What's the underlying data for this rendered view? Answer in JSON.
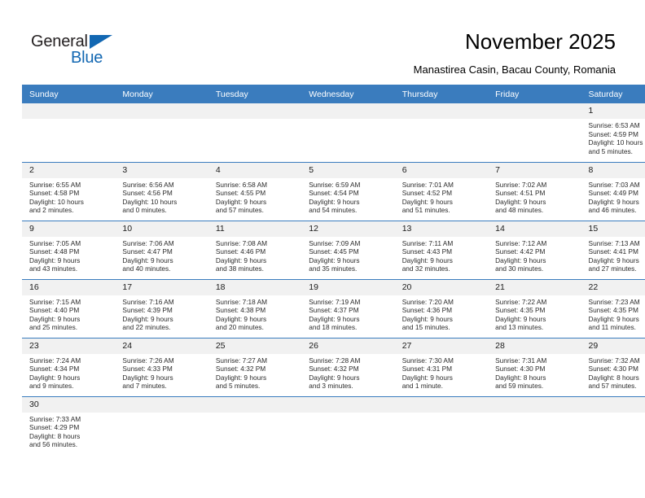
{
  "brand": {
    "name_top": "General",
    "name_bottom": "Blue",
    "triangle_color": "#1267b2",
    "text_color": "#231f20"
  },
  "header": {
    "title": "November 2025",
    "subtitle": "Manastirea Casin, Bacau County, Romania"
  },
  "theme": {
    "header_bg": "#3a7cbe",
    "header_text": "#ffffff",
    "daynum_bg": "#f1f1f1",
    "grid_line": "#3a7cbe",
    "body_text": "#2b2b2b"
  },
  "weekdays": [
    "Sunday",
    "Monday",
    "Tuesday",
    "Wednesday",
    "Thursday",
    "Friday",
    "Saturday"
  ],
  "labels": {
    "sunrise": "Sunrise:",
    "sunset": "Sunset:",
    "daylight": "Daylight:"
  },
  "weeks": [
    [
      {
        "empty": true
      },
      {
        "empty": true
      },
      {
        "empty": true
      },
      {
        "empty": true
      },
      {
        "empty": true
      },
      {
        "empty": true
      },
      {
        "day": "1",
        "sunrise": "Sunrise: 6:53 AM",
        "sunset": "Sunset: 4:59 PM",
        "daylight1": "Daylight: 10 hours",
        "daylight2": "and 5 minutes."
      }
    ],
    [
      {
        "day": "2",
        "sunrise": "Sunrise: 6:55 AM",
        "sunset": "Sunset: 4:58 PM",
        "daylight1": "Daylight: 10 hours",
        "daylight2": "and 2 minutes."
      },
      {
        "day": "3",
        "sunrise": "Sunrise: 6:56 AM",
        "sunset": "Sunset: 4:56 PM",
        "daylight1": "Daylight: 10 hours",
        "daylight2": "and 0 minutes."
      },
      {
        "day": "4",
        "sunrise": "Sunrise: 6:58 AM",
        "sunset": "Sunset: 4:55 PM",
        "daylight1": "Daylight: 9 hours",
        "daylight2": "and 57 minutes."
      },
      {
        "day": "5",
        "sunrise": "Sunrise: 6:59 AM",
        "sunset": "Sunset: 4:54 PM",
        "daylight1": "Daylight: 9 hours",
        "daylight2": "and 54 minutes."
      },
      {
        "day": "6",
        "sunrise": "Sunrise: 7:01 AM",
        "sunset": "Sunset: 4:52 PM",
        "daylight1": "Daylight: 9 hours",
        "daylight2": "and 51 minutes."
      },
      {
        "day": "7",
        "sunrise": "Sunrise: 7:02 AM",
        "sunset": "Sunset: 4:51 PM",
        "daylight1": "Daylight: 9 hours",
        "daylight2": "and 48 minutes."
      },
      {
        "day": "8",
        "sunrise": "Sunrise: 7:03 AM",
        "sunset": "Sunset: 4:49 PM",
        "daylight1": "Daylight: 9 hours",
        "daylight2": "and 46 minutes."
      }
    ],
    [
      {
        "day": "9",
        "sunrise": "Sunrise: 7:05 AM",
        "sunset": "Sunset: 4:48 PM",
        "daylight1": "Daylight: 9 hours",
        "daylight2": "and 43 minutes."
      },
      {
        "day": "10",
        "sunrise": "Sunrise: 7:06 AM",
        "sunset": "Sunset: 4:47 PM",
        "daylight1": "Daylight: 9 hours",
        "daylight2": "and 40 minutes."
      },
      {
        "day": "11",
        "sunrise": "Sunrise: 7:08 AM",
        "sunset": "Sunset: 4:46 PM",
        "daylight1": "Daylight: 9 hours",
        "daylight2": "and 38 minutes."
      },
      {
        "day": "12",
        "sunrise": "Sunrise: 7:09 AM",
        "sunset": "Sunset: 4:45 PM",
        "daylight1": "Daylight: 9 hours",
        "daylight2": "and 35 minutes."
      },
      {
        "day": "13",
        "sunrise": "Sunrise: 7:11 AM",
        "sunset": "Sunset: 4:43 PM",
        "daylight1": "Daylight: 9 hours",
        "daylight2": "and 32 minutes."
      },
      {
        "day": "14",
        "sunrise": "Sunrise: 7:12 AM",
        "sunset": "Sunset: 4:42 PM",
        "daylight1": "Daylight: 9 hours",
        "daylight2": "and 30 minutes."
      },
      {
        "day": "15",
        "sunrise": "Sunrise: 7:13 AM",
        "sunset": "Sunset: 4:41 PM",
        "daylight1": "Daylight: 9 hours",
        "daylight2": "and 27 minutes."
      }
    ],
    [
      {
        "day": "16",
        "sunrise": "Sunrise: 7:15 AM",
        "sunset": "Sunset: 4:40 PM",
        "daylight1": "Daylight: 9 hours",
        "daylight2": "and 25 minutes."
      },
      {
        "day": "17",
        "sunrise": "Sunrise: 7:16 AM",
        "sunset": "Sunset: 4:39 PM",
        "daylight1": "Daylight: 9 hours",
        "daylight2": "and 22 minutes."
      },
      {
        "day": "18",
        "sunrise": "Sunrise: 7:18 AM",
        "sunset": "Sunset: 4:38 PM",
        "daylight1": "Daylight: 9 hours",
        "daylight2": "and 20 minutes."
      },
      {
        "day": "19",
        "sunrise": "Sunrise: 7:19 AM",
        "sunset": "Sunset: 4:37 PM",
        "daylight1": "Daylight: 9 hours",
        "daylight2": "and 18 minutes."
      },
      {
        "day": "20",
        "sunrise": "Sunrise: 7:20 AM",
        "sunset": "Sunset: 4:36 PM",
        "daylight1": "Daylight: 9 hours",
        "daylight2": "and 15 minutes."
      },
      {
        "day": "21",
        "sunrise": "Sunrise: 7:22 AM",
        "sunset": "Sunset: 4:35 PM",
        "daylight1": "Daylight: 9 hours",
        "daylight2": "and 13 minutes."
      },
      {
        "day": "22",
        "sunrise": "Sunrise: 7:23 AM",
        "sunset": "Sunset: 4:35 PM",
        "daylight1": "Daylight: 9 hours",
        "daylight2": "and 11 minutes."
      }
    ],
    [
      {
        "day": "23",
        "sunrise": "Sunrise: 7:24 AM",
        "sunset": "Sunset: 4:34 PM",
        "daylight1": "Daylight: 9 hours",
        "daylight2": "and 9 minutes."
      },
      {
        "day": "24",
        "sunrise": "Sunrise: 7:26 AM",
        "sunset": "Sunset: 4:33 PM",
        "daylight1": "Daylight: 9 hours",
        "daylight2": "and 7 minutes."
      },
      {
        "day": "25",
        "sunrise": "Sunrise: 7:27 AM",
        "sunset": "Sunset: 4:32 PM",
        "daylight1": "Daylight: 9 hours",
        "daylight2": "and 5 minutes."
      },
      {
        "day": "26",
        "sunrise": "Sunrise: 7:28 AM",
        "sunset": "Sunset: 4:32 PM",
        "daylight1": "Daylight: 9 hours",
        "daylight2": "and 3 minutes."
      },
      {
        "day": "27",
        "sunrise": "Sunrise: 7:30 AM",
        "sunset": "Sunset: 4:31 PM",
        "daylight1": "Daylight: 9 hours",
        "daylight2": "and 1 minute."
      },
      {
        "day": "28",
        "sunrise": "Sunrise: 7:31 AM",
        "sunset": "Sunset: 4:30 PM",
        "daylight1": "Daylight: 8 hours",
        "daylight2": "and 59 minutes."
      },
      {
        "day": "29",
        "sunrise": "Sunrise: 7:32 AM",
        "sunset": "Sunset: 4:30 PM",
        "daylight1": "Daylight: 8 hours",
        "daylight2": "and 57 minutes."
      }
    ],
    [
      {
        "day": "30",
        "sunrise": "Sunrise: 7:33 AM",
        "sunset": "Sunset: 4:29 PM",
        "daylight1": "Daylight: 8 hours",
        "daylight2": "and 56 minutes."
      },
      {
        "empty": true
      },
      {
        "empty": true
      },
      {
        "empty": true
      },
      {
        "empty": true
      },
      {
        "empty": true
      },
      {
        "empty": true
      }
    ]
  ]
}
